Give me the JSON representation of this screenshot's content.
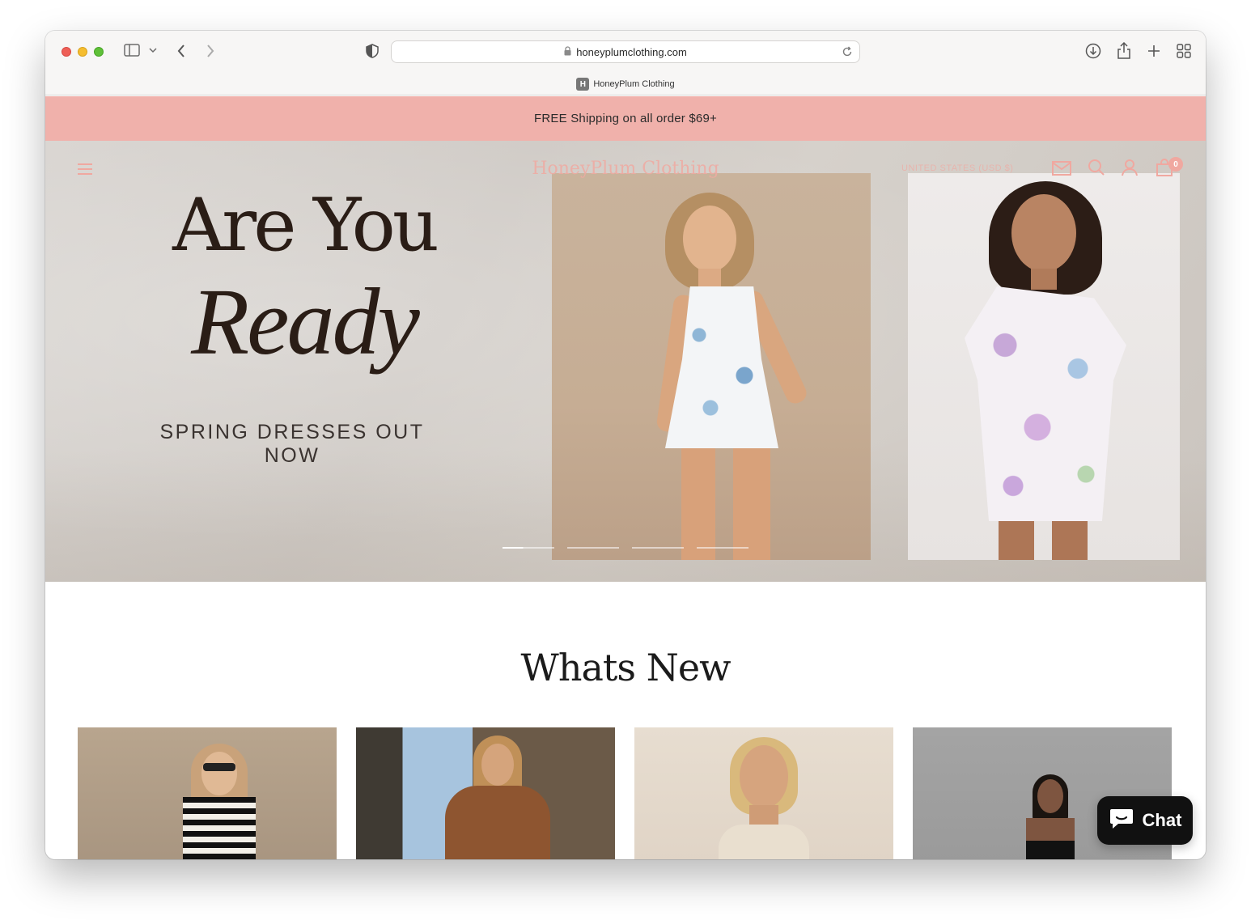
{
  "browser": {
    "url": "honeyplumclothing.com",
    "tab_title": "HoneyPlum Clothing",
    "favicon_letter": "H"
  },
  "announcement": {
    "text": "FREE Shipping on all order $69+"
  },
  "header": {
    "logo": "HoneyPlum Clothing",
    "currency": "UNITED STATES (USD $)",
    "cart_count": "0",
    "accent_color": "#f0a8a0"
  },
  "hero": {
    "headline_line1": "Are You",
    "headline_line2": "Ready",
    "subheading": "SPRING DRESSES OUT NOW",
    "slides_total": 4,
    "active_slide": 1
  },
  "whats_new": {
    "title": "Whats New"
  },
  "chat": {
    "label": "Chat"
  },
  "colors": {
    "announcement_bg": "#f0b1ab",
    "chat_bg": "#111111"
  }
}
